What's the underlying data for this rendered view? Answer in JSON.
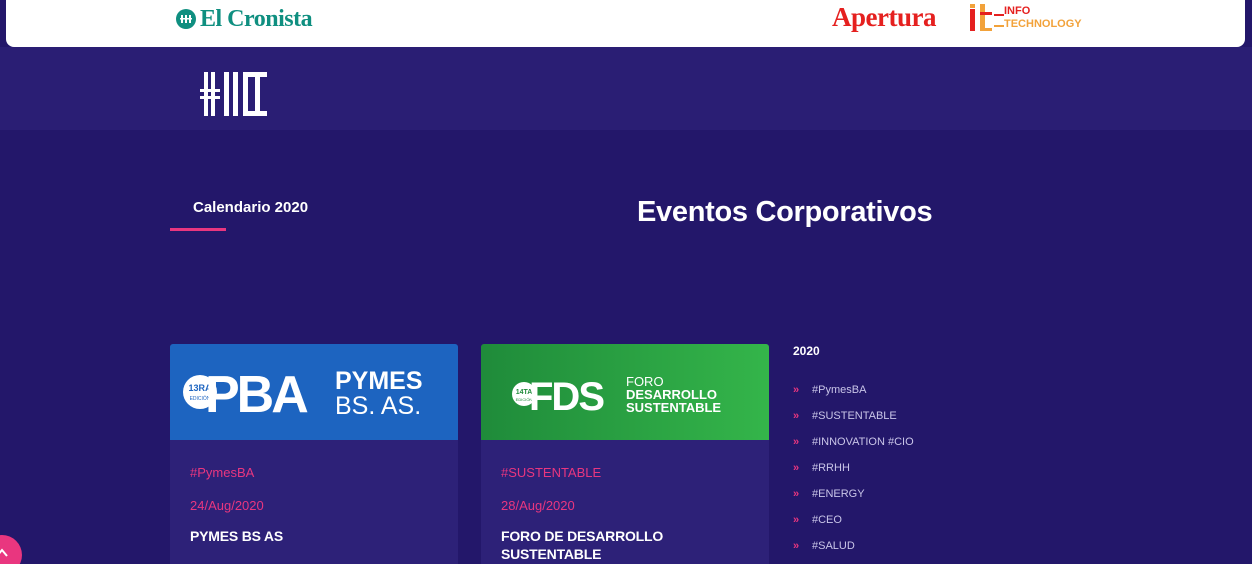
{
  "header": {
    "cronista_logo_text": "El Cronista",
    "apertura_logo_text": "Apertura",
    "it_logo_top": "INFO",
    "it_logo_bottom": "TECHNOLOGY"
  },
  "tabs": {
    "calendar_label": "Calendario 2020"
  },
  "page": {
    "title": "Eventos Corporativos"
  },
  "cards": [
    {
      "banner_edition": "13RA",
      "banner_edition_sub": "EDICIÓN",
      "banner_big": "PBA",
      "banner_line1": "PYMES",
      "banner_line2": "BS. AS.",
      "tag": "#PymesBA",
      "date": "24/Aug/2020",
      "title": "PYMES BS AS"
    },
    {
      "banner_edition": "14TA",
      "banner_edition_sub": "EDICIÓN",
      "banner_big": "FDS",
      "banner_line1": "FORO",
      "banner_line2": "DESARROLLO",
      "banner_line3": "SUSTENTABLE",
      "tag": "#SUSTENTABLE",
      "date": "28/Aug/2020",
      "title": "FORO DE DESARROLLO SUSTENTABLE"
    }
  ],
  "sidebar": {
    "year": "2020",
    "items": [
      {
        "label": "#PymesBA"
      },
      {
        "label": "#SUSTENTABLE"
      },
      {
        "label": "#INNOVATION #CIO"
      },
      {
        "label": "#RRHH"
      },
      {
        "label": "#ENERGY"
      },
      {
        "label": "#CEO"
      },
      {
        "label": "#SALUD"
      }
    ],
    "arrow_glyph": "»"
  },
  "colors": {
    "background": "#23176a",
    "accent_pink": "#e9367f",
    "cronista_teal": "#0f8f80",
    "apertura_red": "#e5201f",
    "pba_blue": "#1d64c0",
    "fds_green": "#2ea345"
  },
  "icons": {
    "scroll_top": "chevron-up-icon"
  }
}
